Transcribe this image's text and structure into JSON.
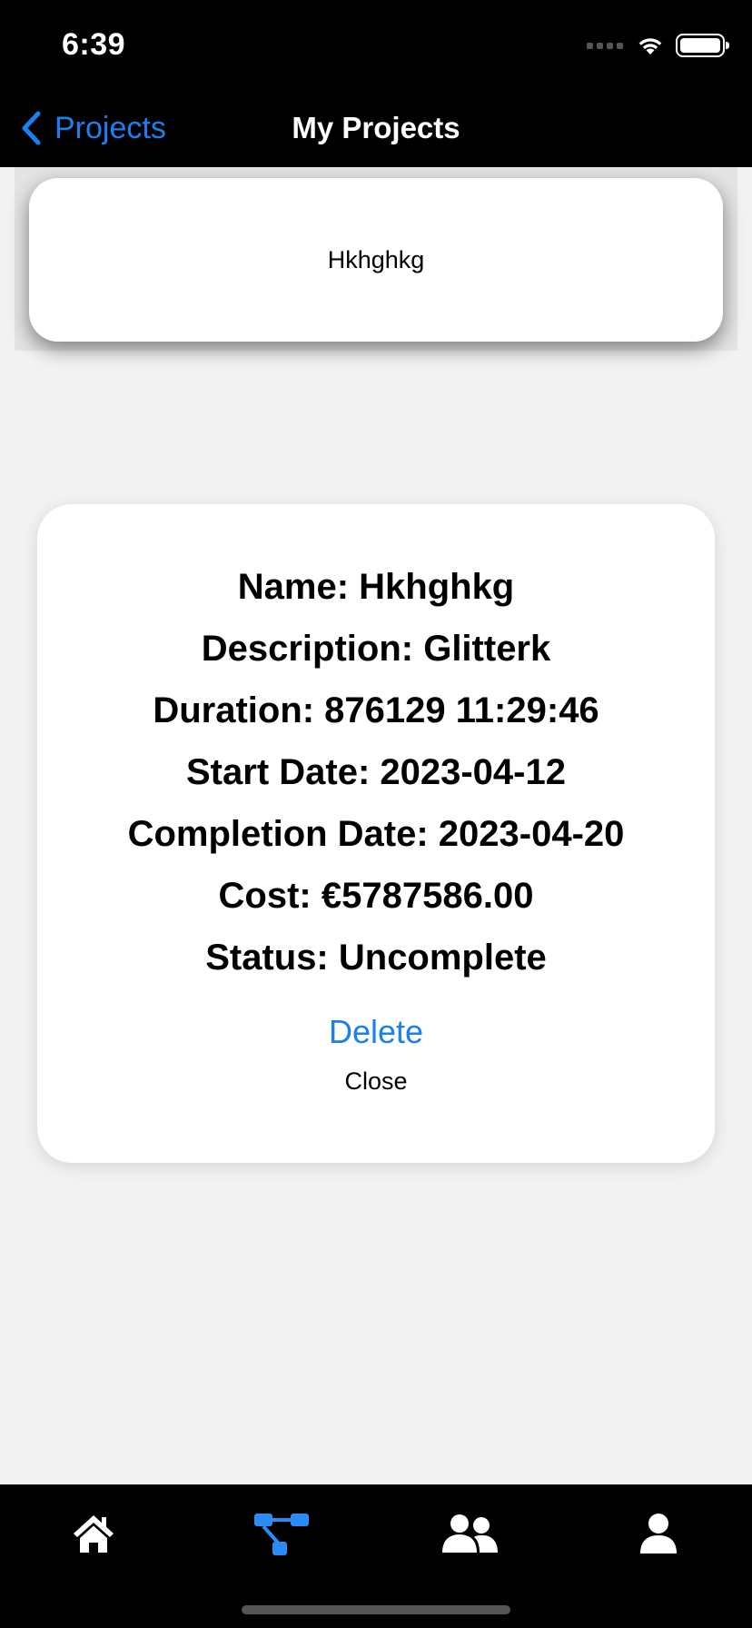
{
  "status_bar": {
    "time": "6:39"
  },
  "nav": {
    "back_label": "Projects",
    "title": "My Projects"
  },
  "projects": [
    {
      "name": "Hkhghkg"
    }
  ],
  "detail": {
    "lines": [
      "Name: Hkhghkg",
      "Description: Glitterk",
      "Duration: 876129 11:29:46",
      "Start Date: 2023-04-12",
      "Completion Date: 2023-04-20",
      "Cost: €5787586.00",
      "Status: Uncomplete"
    ],
    "delete_label": "Delete",
    "close_label": "Close"
  },
  "tabs": [
    {
      "icon": "home-icon",
      "active": false
    },
    {
      "icon": "project-tree-icon",
      "active": true
    },
    {
      "icon": "team-icon",
      "active": false
    },
    {
      "icon": "profile-icon",
      "active": false
    }
  ],
  "colors": {
    "accent": "#1a7ff0",
    "bar": "#000000",
    "background": "#f2f2f2"
  }
}
